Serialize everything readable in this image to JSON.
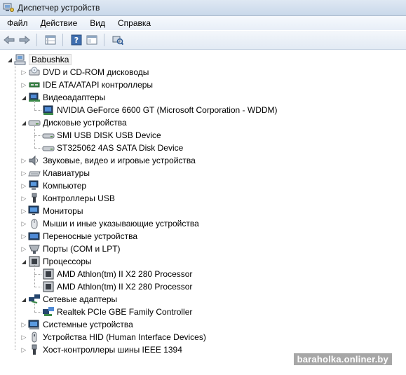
{
  "window": {
    "title": "Диспетчер устройств"
  },
  "menu": [
    "Файл",
    "Действие",
    "Вид",
    "Справка"
  ],
  "toolbar": {
    "buttons": [
      "back-icon",
      "forward-icon",
      "properties-grid-icon",
      "help-icon",
      "console-tree-icon",
      "scan-hardware-icon"
    ]
  },
  "tree": {
    "root": "Babushka",
    "categories": [
      {
        "label": "DVD и CD-ROM дисководы",
        "icon": "dvd-drive-icon",
        "expanded": false
      },
      {
        "label": "IDE ATA/ATAPI контроллеры",
        "icon": "ide-controller-icon",
        "expanded": false
      },
      {
        "label": "Видеоадаптеры",
        "icon": "display-adapter-icon",
        "expanded": true,
        "children": [
          "NVIDIA GeForce 6600 GT (Microsoft Corporation - WDDM)"
        ]
      },
      {
        "label": "Дисковые устройства",
        "icon": "disk-drive-icon",
        "expanded": true,
        "children": [
          "SMI USB DISK USB Device",
          "ST325062 4AS SATA Disk Device"
        ]
      },
      {
        "label": "Звуковые, видео и игровые устройства",
        "icon": "sound-icon",
        "expanded": false
      },
      {
        "label": "Клавиатуры",
        "icon": "keyboard-icon",
        "expanded": false
      },
      {
        "label": "Компьютер",
        "icon": "computer-icon",
        "expanded": false
      },
      {
        "label": "Контроллеры USB",
        "icon": "usb-icon",
        "expanded": false
      },
      {
        "label": "Мониторы",
        "icon": "monitor-icon",
        "expanded": false
      },
      {
        "label": "Мыши и иные указывающие устройства",
        "icon": "mouse-icon",
        "expanded": false
      },
      {
        "label": "Переносные устройства",
        "icon": "portable-device-icon",
        "expanded": false
      },
      {
        "label": "Порты (COM и LPT)",
        "icon": "port-icon",
        "expanded": false
      },
      {
        "label": "Процессоры",
        "icon": "processor-icon",
        "expanded": true,
        "children": [
          "AMD Athlon(tm) II X2 280 Processor",
          "AMD Athlon(tm) II X2 280 Processor"
        ]
      },
      {
        "label": "Сетевые адаптеры",
        "icon": "network-adapter-icon",
        "expanded": true,
        "children": [
          "Realtek PCIe GBE Family Controller"
        ]
      },
      {
        "label": "Системные устройства",
        "icon": "system-device-icon",
        "expanded": false
      },
      {
        "label": "Устройства HID (Human Interface Devices)",
        "icon": "hid-icon",
        "expanded": false
      },
      {
        "label": "Хост-контроллеры шины IEEE 1394",
        "icon": "ieee1394-icon",
        "expanded": false
      }
    ]
  },
  "watermark": "baraholka.onliner.by"
}
